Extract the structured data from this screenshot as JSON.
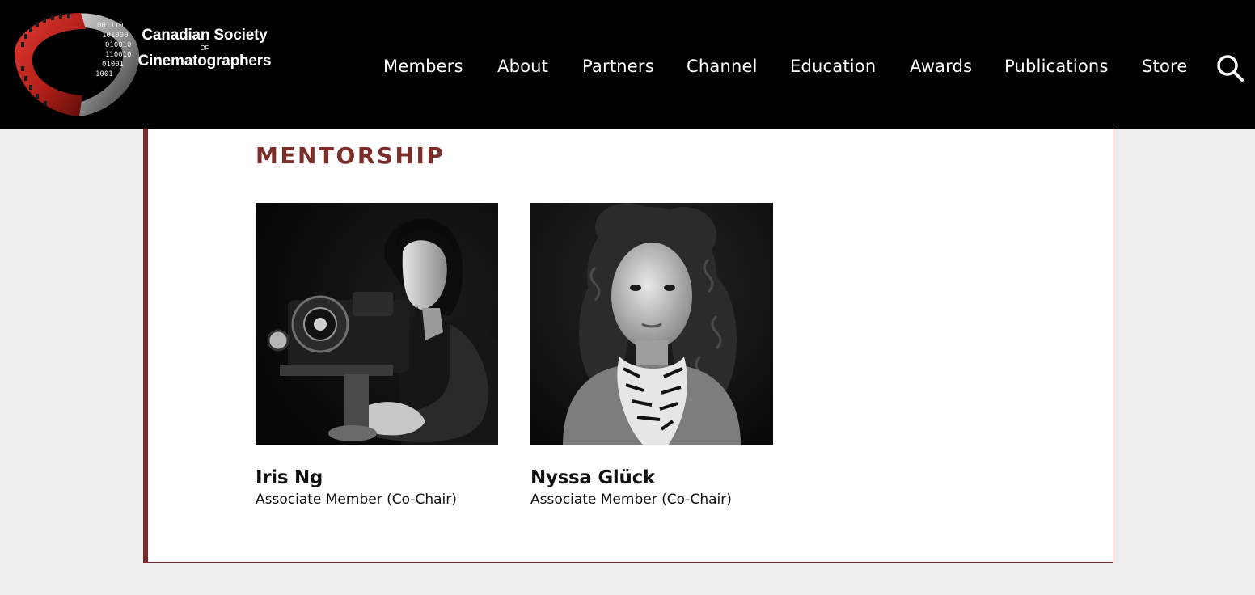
{
  "brand": {
    "line1": "Canadian Society",
    "line2": "OF",
    "line3": "Cinematographers",
    "accent": "#7b2d2a"
  },
  "nav": {
    "items": [
      {
        "label": "Members"
      },
      {
        "label": "About"
      },
      {
        "label": "Partners"
      },
      {
        "label": "Channel"
      },
      {
        "label": "Education"
      },
      {
        "label": "Awards"
      },
      {
        "label": "Publications"
      },
      {
        "label": "Store"
      }
    ],
    "search_icon": "search-icon"
  },
  "section": {
    "title": "MENTORSHIP"
  },
  "people": [
    {
      "name": "Iris Ng",
      "role": "Associate Member (Co-Chair)"
    },
    {
      "name": "Nyssa Glück",
      "role": "Associate Member (Co-Chair)"
    }
  ]
}
